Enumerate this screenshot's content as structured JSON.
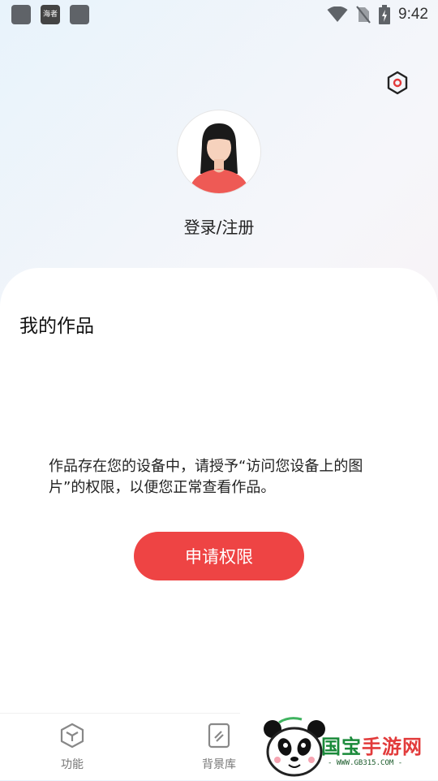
{
  "status_bar": {
    "time": "9:42",
    "notification_app_label": "海者"
  },
  "profile": {
    "login_label": "登录/注册"
  },
  "works": {
    "title": "我的作品",
    "permission_notice": "作品存在您的设备中，请授予“访问您设备上的图片”的权限，以便您正常查看作品。",
    "request_button_label": "申请权限"
  },
  "tabs": [
    {
      "label": "功能",
      "icon": "cube-icon"
    },
    {
      "label": "背景库",
      "icon": "pattern-icon"
    }
  ],
  "watermark": {
    "brand_part1": "国宝",
    "brand_part2": "手游网",
    "url": "- WWW.GB315.COM -"
  },
  "colors": {
    "accent": "#ee4444",
    "brand_green": "#1a8a3a"
  }
}
